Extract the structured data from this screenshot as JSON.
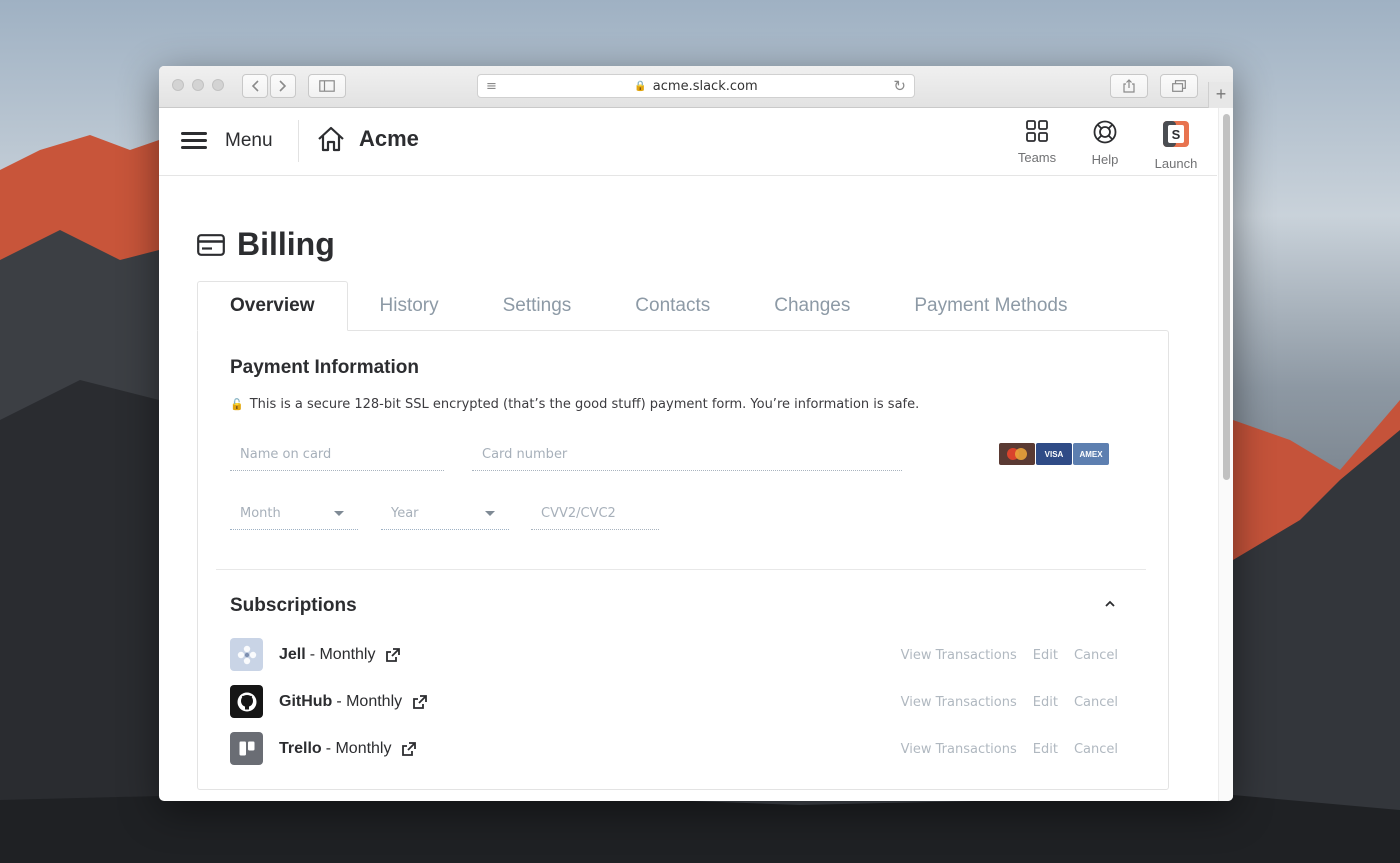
{
  "browser": {
    "url": "acme.slack.com",
    "new_tab_symbol": "+"
  },
  "header": {
    "menu_label": "Menu",
    "team_name": "Acme",
    "actions": [
      {
        "label": "Teams",
        "icon": "grid-icon"
      },
      {
        "label": "Help",
        "icon": "lifebuoy-icon"
      },
      {
        "label": "Launch",
        "icon": "slack-launch-icon"
      }
    ]
  },
  "page": {
    "title": "Billing",
    "tabs": [
      {
        "label": "Overview",
        "active": true
      },
      {
        "label": "History",
        "active": false
      },
      {
        "label": "Settings",
        "active": false
      },
      {
        "label": "Contacts",
        "active": false
      },
      {
        "label": "Changes",
        "active": false
      },
      {
        "label": "Payment Methods",
        "active": false
      }
    ]
  },
  "payment": {
    "title": "Payment Information",
    "secure_note": "This is a secure 128-bit SSL encrypted (that’s the good stuff) payment form. You’re information is safe.",
    "name_placeholder": "Name on card",
    "card_placeholder": "Card number",
    "month_placeholder": "Month",
    "year_placeholder": "Year",
    "cvv_placeholder": "CVV2/CVC2",
    "card_logos": [
      "MasterCard",
      "VISA",
      "AMEX"
    ]
  },
  "subscriptions": {
    "title": "Subscriptions",
    "items": [
      {
        "name": "Jell",
        "plan": "- Monthly",
        "icon": "jell-logo-icon"
      },
      {
        "name": "GitHub",
        "plan": "- Monthly",
        "icon": "github-logo-icon"
      },
      {
        "name": "Trello",
        "plan": "- Monthly",
        "icon": "trello-logo-icon"
      }
    ],
    "view_label": "View Transactions",
    "edit_label": "Edit",
    "cancel_label": "Cancel"
  },
  "colors": {
    "text_dark": "#2c2d30",
    "tab_inactive": "#8d9aa6",
    "muted": "#b0b8c0"
  }
}
